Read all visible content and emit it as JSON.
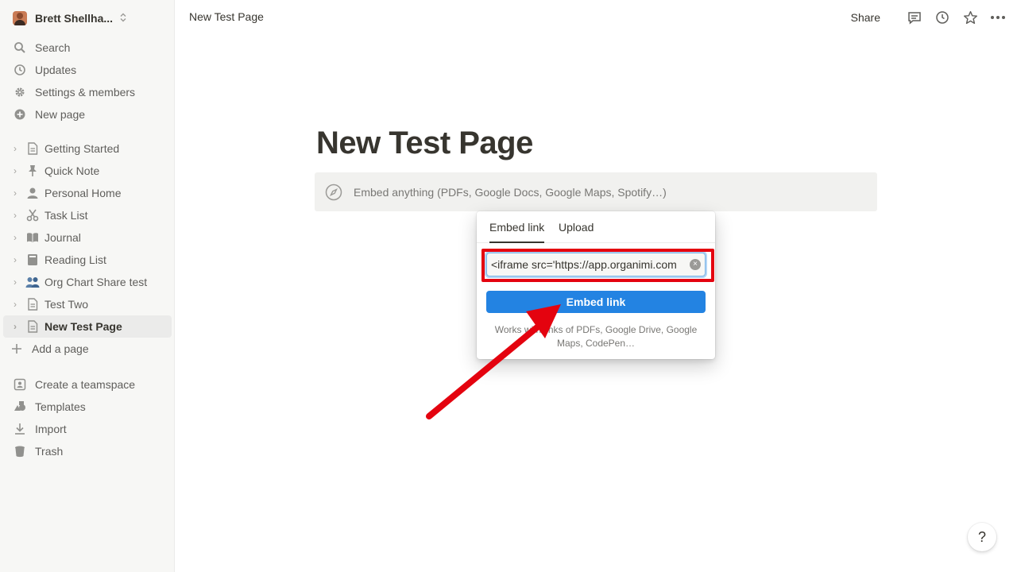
{
  "workspace": {
    "name": "Brett Shellha...",
    "switch_icon": "chevron-updown-icon"
  },
  "sidebar": {
    "nav": [
      {
        "label": "Search",
        "icon": "search-icon"
      },
      {
        "label": "Updates",
        "icon": "clock-icon"
      },
      {
        "label": "Settings & members",
        "icon": "gear-icon"
      },
      {
        "label": "New page",
        "icon": "plus-circle-icon"
      }
    ],
    "pages": [
      {
        "label": "Getting Started",
        "icon": "page-icon"
      },
      {
        "label": "Quick Note",
        "icon": "pin-icon"
      },
      {
        "label": "Personal Home",
        "icon": "person-icon"
      },
      {
        "label": "Task List",
        "icon": "scissors-icon"
      },
      {
        "label": "Journal",
        "icon": "book-icon"
      },
      {
        "label": "Reading List",
        "icon": "bookshelf-icon"
      },
      {
        "label": "Org Chart Share test",
        "icon": "people-emoji-icon"
      },
      {
        "label": "Test Two",
        "icon": "page-icon"
      },
      {
        "label": "New Test Page",
        "icon": "page-icon",
        "active": true
      }
    ],
    "add_page": "Add a page",
    "bottom": [
      {
        "label": "Create a teamspace",
        "icon": "teamspace-icon"
      },
      {
        "label": "Templates",
        "icon": "shapes-icon"
      },
      {
        "label": "Import",
        "icon": "download-icon"
      },
      {
        "label": "Trash",
        "icon": "trash-icon"
      }
    ]
  },
  "topbar": {
    "title": "New Test Page",
    "share_label": "Share",
    "icons": [
      "comment-icon",
      "clock-icon",
      "star-icon",
      "more-icon"
    ]
  },
  "main": {
    "page_title": "New Test Page",
    "embed_placeholder": "Embed anything (PDFs, Google Docs, Google Maps, Spotify…)"
  },
  "embed_popup": {
    "tabs": [
      "Embed link",
      "Upload"
    ],
    "active_tab": "Embed link",
    "url_value": "<iframe src='https://app.organimi.com",
    "button_label": "Embed link",
    "help_text": "Works with links of PDFs, Google Drive, Google Maps, CodePen…"
  },
  "annotation": {
    "color": "#e4030f"
  },
  "help_button": "?",
  "colors": {
    "accent": "#2383e2",
    "sidebar_bg": "#f7f7f5",
    "text": "#37352f"
  }
}
